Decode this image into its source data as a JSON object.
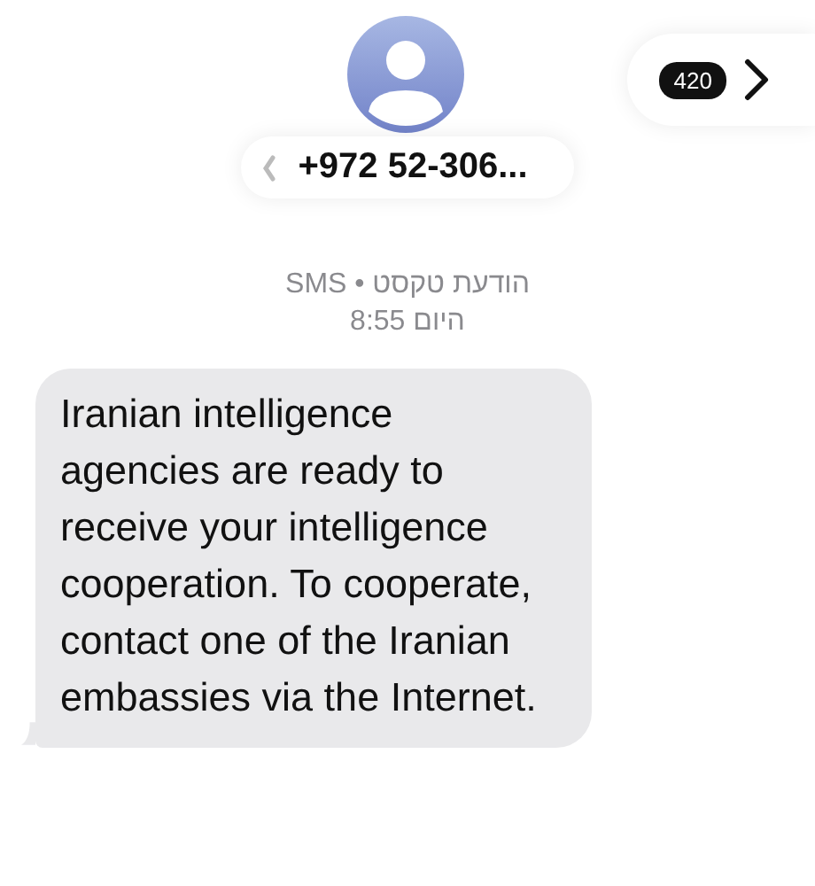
{
  "header": {
    "contact": "+972 52-306...",
    "unread_count": "420"
  },
  "message_meta": {
    "service": "הודעת טקסט • SMS",
    "time": "היום 8:55"
  },
  "messages": [
    {
      "kind": "incoming",
      "text": "Iranian intelligence agencies are ready to receive your intelligence cooperation. To cooperate, contact one of the Iranian embassies via the Internet."
    }
  ]
}
